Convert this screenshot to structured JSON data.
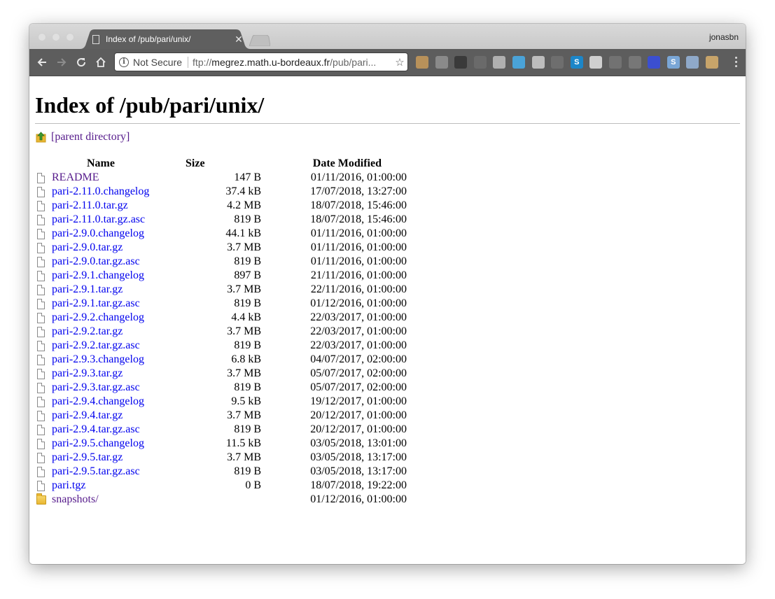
{
  "window": {
    "tab_title": "Index of /pub/pari/unix/",
    "profile_name": "jonasbn"
  },
  "toolbar": {
    "security_label": "Not Secure",
    "url_scheme": "ftp://",
    "url_host": "megrez.math.u-bordeaux.fr",
    "url_path": "/pub/pari..."
  },
  "page": {
    "heading": "Index of /pub/pari/unix/",
    "parent_link": "[parent directory]",
    "columns": {
      "name": "Name",
      "size": "Size",
      "date": "Date Modified"
    },
    "entries": [
      {
        "name": "README",
        "size": "147 B",
        "date": "01/11/2016, 01:00:00",
        "type": "file",
        "visited": true
      },
      {
        "name": "pari-2.11.0.changelog",
        "size": "37.4 kB",
        "date": "17/07/2018, 13:27:00",
        "type": "file",
        "visited": false
      },
      {
        "name": "pari-2.11.0.tar.gz",
        "size": "4.2 MB",
        "date": "18/07/2018, 15:46:00",
        "type": "file",
        "visited": false
      },
      {
        "name": "pari-2.11.0.tar.gz.asc",
        "size": "819 B",
        "date": "18/07/2018, 15:46:00",
        "type": "file",
        "visited": false
      },
      {
        "name": "pari-2.9.0.changelog",
        "size": "44.1 kB",
        "date": "01/11/2016, 01:00:00",
        "type": "file",
        "visited": false
      },
      {
        "name": "pari-2.9.0.tar.gz",
        "size": "3.7 MB",
        "date": "01/11/2016, 01:00:00",
        "type": "file",
        "visited": false
      },
      {
        "name": "pari-2.9.0.tar.gz.asc",
        "size": "819 B",
        "date": "01/11/2016, 01:00:00",
        "type": "file",
        "visited": false
      },
      {
        "name": "pari-2.9.1.changelog",
        "size": "897 B",
        "date": "21/11/2016, 01:00:00",
        "type": "file",
        "visited": false
      },
      {
        "name": "pari-2.9.1.tar.gz",
        "size": "3.7 MB",
        "date": "22/11/2016, 01:00:00",
        "type": "file",
        "visited": false
      },
      {
        "name": "pari-2.9.1.tar.gz.asc",
        "size": "819 B",
        "date": "01/12/2016, 01:00:00",
        "type": "file",
        "visited": false
      },
      {
        "name": "pari-2.9.2.changelog",
        "size": "4.4 kB",
        "date": "22/03/2017, 01:00:00",
        "type": "file",
        "visited": false
      },
      {
        "name": "pari-2.9.2.tar.gz",
        "size": "3.7 MB",
        "date": "22/03/2017, 01:00:00",
        "type": "file",
        "visited": false
      },
      {
        "name": "pari-2.9.2.tar.gz.asc",
        "size": "819 B",
        "date": "22/03/2017, 01:00:00",
        "type": "file",
        "visited": false
      },
      {
        "name": "pari-2.9.3.changelog",
        "size": "6.8 kB",
        "date": "04/07/2017, 02:00:00",
        "type": "file",
        "visited": false
      },
      {
        "name": "pari-2.9.3.tar.gz",
        "size": "3.7 MB",
        "date": "05/07/2017, 02:00:00",
        "type": "file",
        "visited": false
      },
      {
        "name": "pari-2.9.3.tar.gz.asc",
        "size": "819 B",
        "date": "05/07/2017, 02:00:00",
        "type": "file",
        "visited": false
      },
      {
        "name": "pari-2.9.4.changelog",
        "size": "9.5 kB",
        "date": "19/12/2017, 01:00:00",
        "type": "file",
        "visited": false
      },
      {
        "name": "pari-2.9.4.tar.gz",
        "size": "3.7 MB",
        "date": "20/12/2017, 01:00:00",
        "type": "file",
        "visited": false
      },
      {
        "name": "pari-2.9.4.tar.gz.asc",
        "size": "819 B",
        "date": "20/12/2017, 01:00:00",
        "type": "file",
        "visited": false
      },
      {
        "name": "pari-2.9.5.changelog",
        "size": "11.5 kB",
        "date": "03/05/2018, 13:01:00",
        "type": "file",
        "visited": false
      },
      {
        "name": "pari-2.9.5.tar.gz",
        "size": "3.7 MB",
        "date": "03/05/2018, 13:17:00",
        "type": "file",
        "visited": false
      },
      {
        "name": "pari-2.9.5.tar.gz.asc",
        "size": "819 B",
        "date": "03/05/2018, 13:17:00",
        "type": "file",
        "visited": false
      },
      {
        "name": "pari.tgz",
        "size": "0 B",
        "date": "18/07/2018, 19:22:00",
        "type": "file",
        "visited": false
      },
      {
        "name": "snapshots/",
        "size": "",
        "date": "01/12/2016, 01:00:00",
        "type": "folder",
        "visited": true
      }
    ]
  },
  "extensions": [
    {
      "icon": "cookie-extension-icon",
      "color": "#b8915a",
      "glyph": ""
    },
    {
      "icon": "gear-extension-icon",
      "color": "#8a8a8a",
      "glyph": ""
    },
    {
      "icon": "stack-extension-icon",
      "color": "#3a3a3a",
      "glyph": ""
    },
    {
      "icon": "info-extension-icon",
      "color": "#6a6a6a",
      "glyph": ""
    },
    {
      "icon": "tools-extension-icon",
      "color": "#b0b0b0",
      "glyph": ""
    },
    {
      "icon": "pencil-extension-icon",
      "color": "#4aa3d8",
      "glyph": ""
    },
    {
      "icon": "drive-extension-icon",
      "color": "#bdbdbd",
      "glyph": ""
    },
    {
      "icon": "cast-extension-icon",
      "color": "#6e6e6e",
      "glyph": ""
    },
    {
      "icon": "s-extension-icon",
      "color": "#1c86c8",
      "glyph": "S"
    },
    {
      "icon": "circle-extension-icon",
      "color": "#cfcfcf",
      "glyph": ""
    },
    {
      "icon": "flag-extension-icon",
      "color": "#727272",
      "glyph": ""
    },
    {
      "icon": "archive-extension-icon",
      "color": "#777777",
      "glyph": ""
    },
    {
      "icon": "bookmark-extension-icon",
      "color": "#3b4fd0",
      "glyph": ""
    },
    {
      "icon": "skype-extension-icon",
      "color": "#7aa6d6",
      "glyph": "S"
    },
    {
      "icon": "copy-extension-icon",
      "color": "#8fa9c9",
      "glyph": ""
    },
    {
      "icon": "owl-extension-icon",
      "color": "#c7a46a",
      "glyph": ""
    }
  ]
}
